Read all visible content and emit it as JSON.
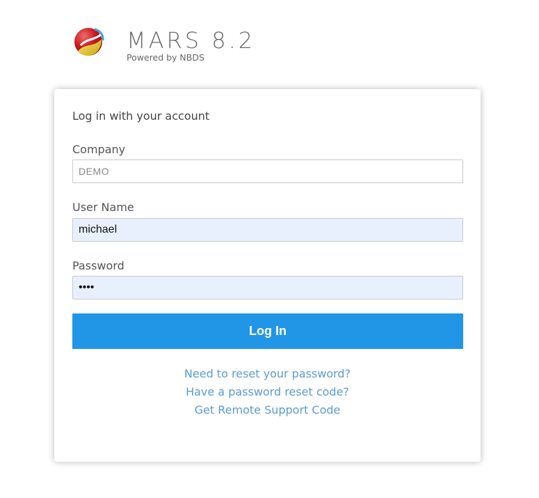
{
  "header": {
    "title": "MARS 8.2",
    "subtitle": "Powered by NBDS",
    "logo_icon": "mars-logo-icon"
  },
  "form": {
    "heading": "Log in with your account",
    "company": {
      "label": "Company",
      "value": "DEMO"
    },
    "username": {
      "label": "User Name",
      "value": "michael"
    },
    "password": {
      "label": "Password",
      "value": "••••"
    },
    "submit_label": "Log In"
  },
  "links": {
    "reset_password": "Need to reset your password?",
    "have_reset_code": "Have a password reset code?",
    "remote_support": "Get Remote Support Code"
  },
  "colors": {
    "primary": "#2196e6",
    "link": "#5b9bd5",
    "autofill_bg": "#e8f0fe"
  }
}
